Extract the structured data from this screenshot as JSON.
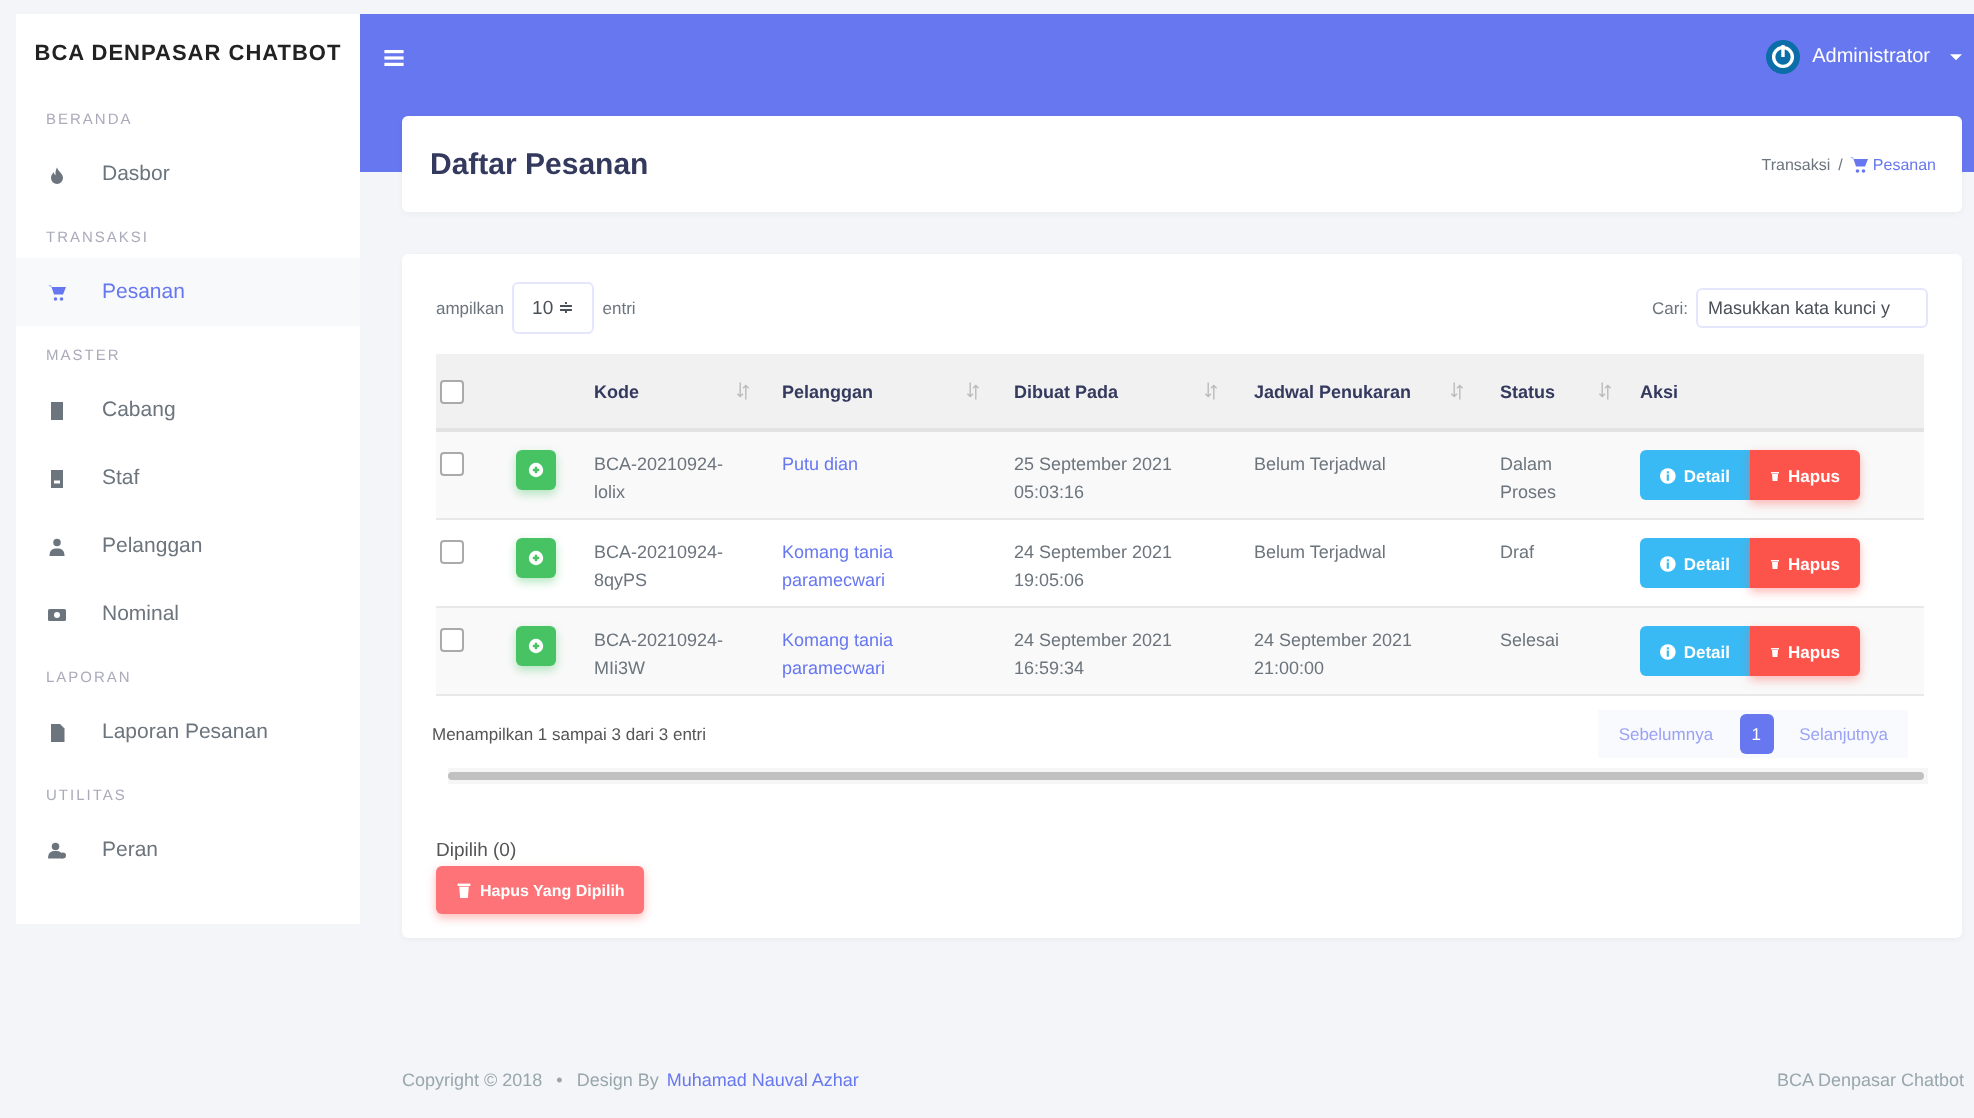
{
  "sidebar": {
    "brand": "BCA DENPASAR CHATBOT",
    "sections": [
      {
        "header": "BERANDA",
        "items": [
          {
            "label": "Dasbor",
            "selected": false
          }
        ]
      },
      {
        "header": "TRANSAKSI",
        "items": [
          {
            "label": "Pesanan",
            "selected": true
          }
        ]
      },
      {
        "header": "MASTER",
        "items": [
          {
            "label": "Cabang",
            "selected": false
          },
          {
            "label": "Staf",
            "selected": false
          },
          {
            "label": "Pelanggan",
            "selected": false
          },
          {
            "label": "Nominal",
            "selected": false
          }
        ]
      },
      {
        "header": "LAPORAN",
        "items": [
          {
            "label": "Laporan Pesanan",
            "selected": false
          }
        ]
      },
      {
        "header": "UTILITAS",
        "items": [
          {
            "label": "Peran",
            "selected": false
          }
        ]
      }
    ]
  },
  "navbar": {
    "user": "Administrator"
  },
  "page_header": {
    "title": "Daftar Pesanan",
    "breadcrumb": [
      "Transaksi",
      "/",
      "Pesanan"
    ]
  },
  "table_controls": {
    "length_prefix": "ampilkan",
    "length_value": "10 ≑",
    "length_suffix": "entri",
    "search_label": "Cari:",
    "search_placeholder": "Masukkan kata kunci y"
  },
  "table": {
    "select_all_checked": false,
    "columns": [
      "Kode",
      "Pelanggan",
      "Dibuat Pada",
      "Jadwal Penukaran",
      "Status",
      "Aksi"
    ],
    "rows": [
      {
        "checked": false,
        "kode": "BCA-20210924-lolix",
        "pelanggan": "Putu dian",
        "dibuat": "25 September 2021 05:03:16",
        "jadwal": "Belum Terjadwal",
        "status": "Dalam Proses",
        "actions": [
          "Detail",
          "Hapus"
        ]
      },
      {
        "checked": false,
        "kode": "BCA-20210924-8qyPS",
        "pelanggan": "Komang tania paramecwari",
        "dibuat": "24 September 2021 19:05:06",
        "jadwal": "Belum Terjadwal",
        "status": "Draf",
        "actions": [
          "Detail",
          "Hapus"
        ]
      },
      {
        "checked": false,
        "kode": "BCA-20210924-MIi3W",
        "pelanggan": "Komang tania paramecwari",
        "dibuat": "24 September 2021 16:59:34",
        "jadwal": "24 September 2021 21:00:00",
        "status": "Selesai",
        "actions": [
          "Detail",
          "Hapus"
        ]
      }
    ]
  },
  "table_info": "Menampilkan 1 sampai 3 dari 3 entri",
  "pagination": {
    "previous": "Sebelumnya",
    "pages": [
      {
        "label": "1",
        "selected": true
      }
    ],
    "next": "Selanjutnya"
  },
  "selection": {
    "count_label": "Dipilih (0)",
    "delete_button": "Hapus Yang Dipilih"
  },
  "footer": {
    "copyright": "Copyright © 2018",
    "separator": "•",
    "design_by": "Design By",
    "author": "Muhamad Nauval Azhar",
    "app_name": "BCA Denpasar Chatbot"
  }
}
